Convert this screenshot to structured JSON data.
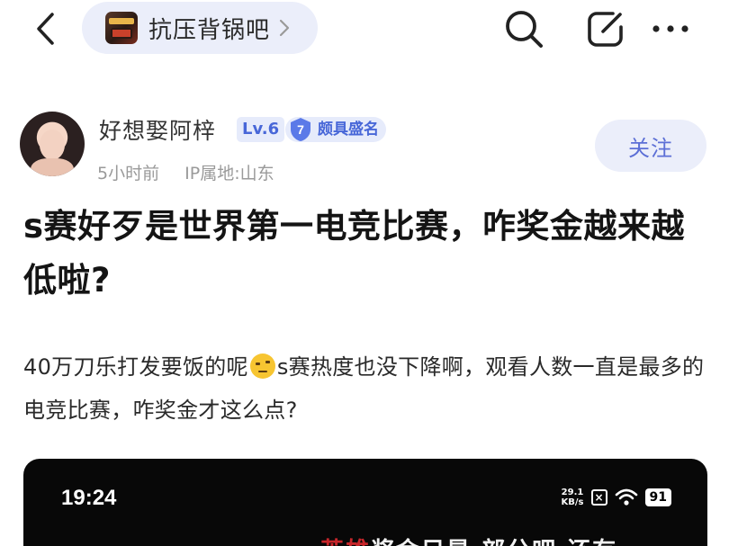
{
  "topbar": {
    "forum_name": "抗压背锅吧",
    "icons": [
      "back-icon",
      "chevron-right-icon",
      "search-icon",
      "edit-icon",
      "more-icon"
    ]
  },
  "author": {
    "name": "好想娶阿梓",
    "level": "Lv.6",
    "badge_number": "7",
    "badge_title": "颇具盛名",
    "time": "5小时前",
    "ip_location": "IP属地:山东",
    "follow_label": "关注"
  },
  "post": {
    "title": "s赛好歹是世界第一电竞比赛，咋奖金越来越低啦?",
    "body_before_emoji": "40万刀乐打发要饭的呢",
    "body_after_emoji": "s赛热度也没下降啊，观看人数一直是最多的电竞比赛，咋奖金才这么点?",
    "emoji": "thinking-face-icon"
  },
  "embed": {
    "time": "19:24",
    "net_speed_value": "29.1",
    "net_speed_unit": "KB/s",
    "battery": "91",
    "caption_red": "英雄",
    "caption_white": "奖金只是 部分吧 还有"
  },
  "colors": {
    "accent": "#5c6fd6",
    "pill_bg": "#ebeefa",
    "badge_text": "#4867d8",
    "caption_red": "#c8262b"
  }
}
